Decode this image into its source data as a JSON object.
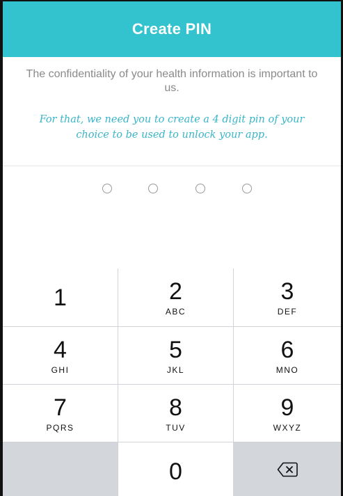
{
  "header": {
    "title": "Create PIN"
  },
  "intro": {
    "text": "The confidentiality of your health information is important to us.",
    "instruction": "For that, we need you to create a 4 digit pin of your choice to be used to unlock your app."
  },
  "pin": {
    "length": 4,
    "entered": 0
  },
  "keypad": {
    "keys": [
      {
        "digit": "1",
        "letters": ""
      },
      {
        "digit": "2",
        "letters": "ABC"
      },
      {
        "digit": "3",
        "letters": "DEF"
      },
      {
        "digit": "4",
        "letters": "GHI"
      },
      {
        "digit": "5",
        "letters": "JKL"
      },
      {
        "digit": "6",
        "letters": "MNO"
      },
      {
        "digit": "7",
        "letters": "PQRS"
      },
      {
        "digit": "8",
        "letters": "TUV"
      },
      {
        "digit": "9",
        "letters": "WXYZ"
      },
      {
        "digit": "0",
        "letters": ""
      }
    ],
    "delete_icon": "backspace-icon"
  },
  "colors": {
    "header": "#33c3cf",
    "instruction": "#3ab5c8",
    "keypad_background": "#d8dbe0"
  }
}
